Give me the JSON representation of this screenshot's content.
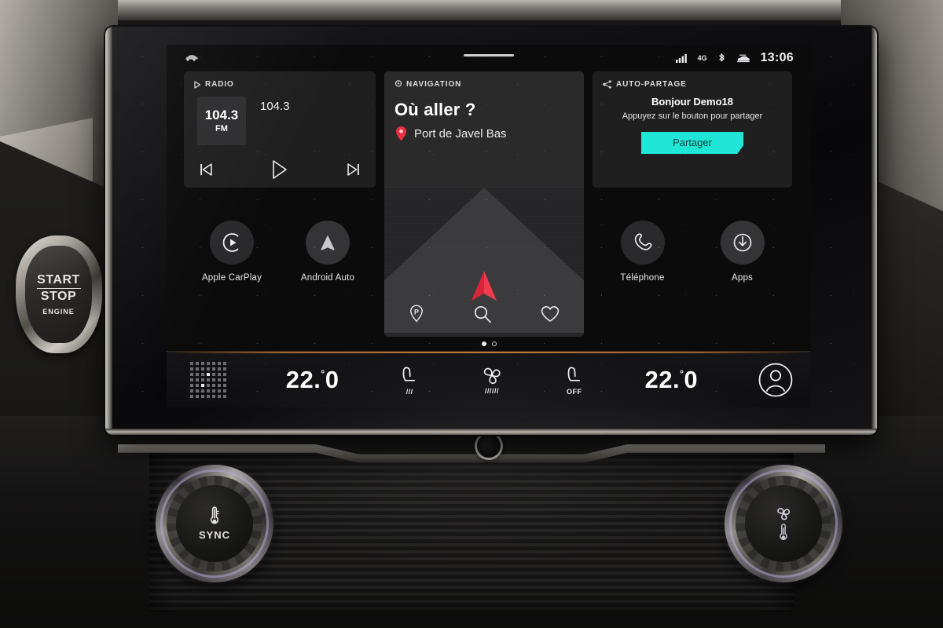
{
  "device": {
    "name": "car-infotainment-head-unit",
    "start_stop": {
      "line1": "START",
      "line2": "STOP",
      "line3": "ENGINE"
    },
    "knob_left_label": "SYNC",
    "knob_right_label": ""
  },
  "status_bar": {
    "car_icon": "car-icon",
    "signal_icon": "signal-bars-icon",
    "network": "4G",
    "bluetooth_icon": "bluetooth-icon",
    "vehicle_icon": "car-status-icon",
    "clock": "13:06"
  },
  "cards": {
    "radio": {
      "header": "RADIO",
      "header_icon": "play-triangle-icon",
      "tile_frequency": "104.3",
      "tile_band": "FM",
      "station_name": "104.3",
      "controls": {
        "previous": "skip-previous-icon",
        "play": "play-icon",
        "next": "skip-next-icon"
      }
    },
    "navigation": {
      "header": "NAVIGATION",
      "header_icon": "location-pin-icon",
      "title": "Où aller ?",
      "destination": "Port de Javel Bas",
      "destination_icon": "map-pin-icon",
      "tools": {
        "parking": "parking-pin-icon",
        "search": "search-icon",
        "favorites": "heart-icon"
      }
    },
    "auto_partage": {
      "header": "AUTO-PARTAGE",
      "header_icon": "share-icon",
      "greeting": "Bonjour Demo18",
      "instruction": "Appuyez sur le bouton pour partager",
      "button_label": "Partager",
      "button_color": "#1fe6d6"
    }
  },
  "apps": {
    "left": [
      {
        "label": "Apple CarPlay",
        "icon": "carplay-icon"
      },
      {
        "label": "Android Auto",
        "icon": "android-auto-icon"
      }
    ],
    "right": [
      {
        "label": "Téléphone",
        "icon": "phone-handset-icon"
      },
      {
        "label": "Apps",
        "icon": "apps-download-icon"
      }
    ]
  },
  "pager": {
    "total": 2,
    "active": 1
  },
  "climate": {
    "launcher_icon": "app-grid-icon",
    "left_temperature": "22.",
    "left_temperature_decimal": "0",
    "right_temperature": "22.",
    "right_temperature_decimal": "0",
    "degree_symbol": "°",
    "driver_seat_heat_icon": "heated-seat-icon",
    "driver_seat_heat_level": "///",
    "fan_icon": "fan-icon",
    "fan_level": "//////",
    "passenger_seat_icon": "seat-icon",
    "passenger_seat_state": "OFF",
    "profile_icon": "user-profile-icon"
  }
}
